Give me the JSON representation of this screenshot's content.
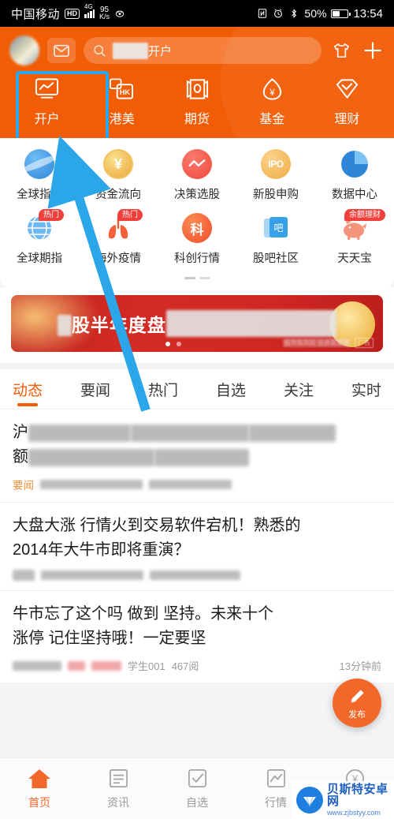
{
  "statusbar": {
    "carrier": "中国移动",
    "hd": "HD",
    "network_gen": "4G",
    "speed_value": "95",
    "speed_unit": "K/s",
    "eye_icon": "eye-icon",
    "nfc_icon": "nfc-icon",
    "alarm_icon": "alarm-icon",
    "bluetooth_icon": "bluetooth-icon",
    "battery_percent": "50%",
    "time": "13:54"
  },
  "header": {
    "background_color": "#f25c05",
    "avatar_name": "user-avatar",
    "mail_icon": "mail-icon",
    "search_placeholder": "开户",
    "search_value": "开户",
    "shirt_icon": "shirt-icon",
    "plus_icon": "plus-icon",
    "categories": [
      {
        "label": "开户",
        "icon": "chart-screen-icon",
        "highlighted": true
      },
      {
        "label": "港美",
        "icon": "hk-icon",
        "highlighted": false
      },
      {
        "label": "期货",
        "icon": "futures-barrel-icon",
        "highlighted": false
      },
      {
        "label": "基金",
        "icon": "fund-egg-icon",
        "highlighted": false
      },
      {
        "label": "理财",
        "icon": "wealth-diamond-icon",
        "highlighted": false
      }
    ],
    "highlight_color": "#2ba6e8"
  },
  "quick_grid": {
    "row1": [
      {
        "label": "全球指数",
        "icon": "globe-blue-icon",
        "badge": ""
      },
      {
        "label": "资金流向",
        "icon": "yuan-coin-icon",
        "badge": ""
      },
      {
        "label": "决策选股",
        "icon": "red-chart-icon",
        "badge": ""
      },
      {
        "label": "新股申购",
        "icon": "ipo-icon",
        "badge": ""
      },
      {
        "label": "数据中心",
        "icon": "pie-chart-icon",
        "badge": ""
      }
    ],
    "row2": [
      {
        "label": "全球期指",
        "icon": "globe-wire-icon",
        "badge": "热门"
      },
      {
        "label": "海外疫情",
        "icon": "lungs-icon",
        "badge": "热门"
      },
      {
        "label": "科创行情",
        "icon": "ke-red-icon",
        "badge": ""
      },
      {
        "label": "股吧社区",
        "icon": "ba-forum-icon",
        "badge": ""
      },
      {
        "label": "天天宝",
        "icon": "piggy-bank-icon",
        "badge": "余额理财"
      }
    ],
    "badge_color": "#f0403c",
    "page_dots": 2,
    "active_dot": 0
  },
  "banner": {
    "title_prefix": "",
    "title": "股半年度盘",
    "dots": 2,
    "active_dot": 0,
    "footer_text": "股市有风险 投资需谨慎",
    "ad_label": "广告"
  },
  "feed_tabs": [
    {
      "label": "动态",
      "active": true
    },
    {
      "label": "要闻",
      "active": false
    },
    {
      "label": "热门",
      "active": false
    },
    {
      "label": "自选",
      "active": false
    },
    {
      "label": "关注",
      "active": false
    },
    {
      "label": "实时",
      "active": false
    }
  ],
  "news": [
    {
      "title_part1": "沪",
      "title_part2": "额",
      "tag": "要闻",
      "source": "东方财富研究",
      "views": "667评"
    },
    {
      "title_line1": "大盘大涨 行情火到交易软件宕机！熟悉的",
      "title_line2": "2014年大牛市即将重演？",
      "tag": "",
      "source": "",
      "views": ""
    },
    {
      "title_line1": "牛市忘了这个吗  做到 坚持。未来十个",
      "title_line2": "涨停 记住坚持哦！一定要坚",
      "author": "学生001",
      "views": "467阅",
      "time": "13分钟前"
    }
  ],
  "fab": {
    "label": "发布",
    "icon": "pencil-icon",
    "color": "#f2682a"
  },
  "bottom_nav": [
    {
      "label": "首页",
      "icon": "home-icon",
      "active": true
    },
    {
      "label": "资讯",
      "icon": "news-list-icon",
      "active": false
    },
    {
      "label": "自选",
      "icon": "checkbox-icon",
      "active": false
    },
    {
      "label": "行情",
      "icon": "market-chart-icon",
      "active": false
    },
    {
      "label": "交易",
      "icon": "yuan-circle-icon",
      "active": false
    }
  ],
  "watermark": {
    "name": "贝斯特安卓网",
    "url": "www.zjbstyy.com"
  },
  "annotation": {
    "arrow_color": "#2ba6e8",
    "description": "blue-arrow-pointing-to-open-account"
  }
}
